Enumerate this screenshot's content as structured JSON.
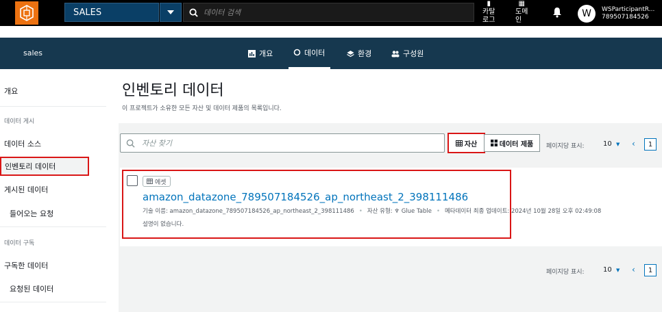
{
  "topbar": {
    "project_name": "SALES",
    "search_placeholder": "데이터 검색",
    "catalog_label_1": "카탈",
    "catalog_label_2": "로그",
    "domain_label_1": "도메",
    "domain_label_2": "인",
    "avatar_initial": "W",
    "user_line1": "WSParticipantR...",
    "user_line2": "789507184526"
  },
  "subnav": {
    "project": "sales",
    "tabs": [
      {
        "label": "개요"
      },
      {
        "label": "데이터"
      },
      {
        "label": "환경"
      },
      {
        "label": "구성원"
      }
    ]
  },
  "sidebar": {
    "overview": "개요",
    "section_publish": "데이터 게시",
    "data_sources": "데이터 소스",
    "inventory": "인벤토리 데이터",
    "published": "게시된 데이터",
    "incoming": "들어오는 요청",
    "section_subscribe": "데이터 구독",
    "subscribed": "구독한 데이터",
    "requested": "요청된 데이터"
  },
  "main": {
    "title": "인벤토리 데이터",
    "description": "이 프로젝트가 소유한 모든 자산 및 데이터 제품의 목록입니다.",
    "search_placeholder": "자산 찾기",
    "toggle_assets": "자산",
    "toggle_products": "데이터 제품",
    "per_page_label": "페이지당 표시:",
    "per_page_value": "10",
    "page_number": "1"
  },
  "asset_card": {
    "badge": "에셋",
    "title": "amazon_datazone_789507184526_ap_northeast_2_398111486",
    "tech_name": "기술 이름: amazon_datazone_789507184526_ap_northeast_2_398111486",
    "asset_type": "자산 유형: ♆ Glue Table",
    "updated": "메타데이터 최종 업데이트: 2024년 10월 28일 오후 02:49:08",
    "description": "설명이 없습니다."
  },
  "colors": {
    "accent_orange": "#ec7211",
    "nav_blue": "#16384f",
    "link_blue": "#0073bb",
    "highlight_red": "#d91515"
  }
}
